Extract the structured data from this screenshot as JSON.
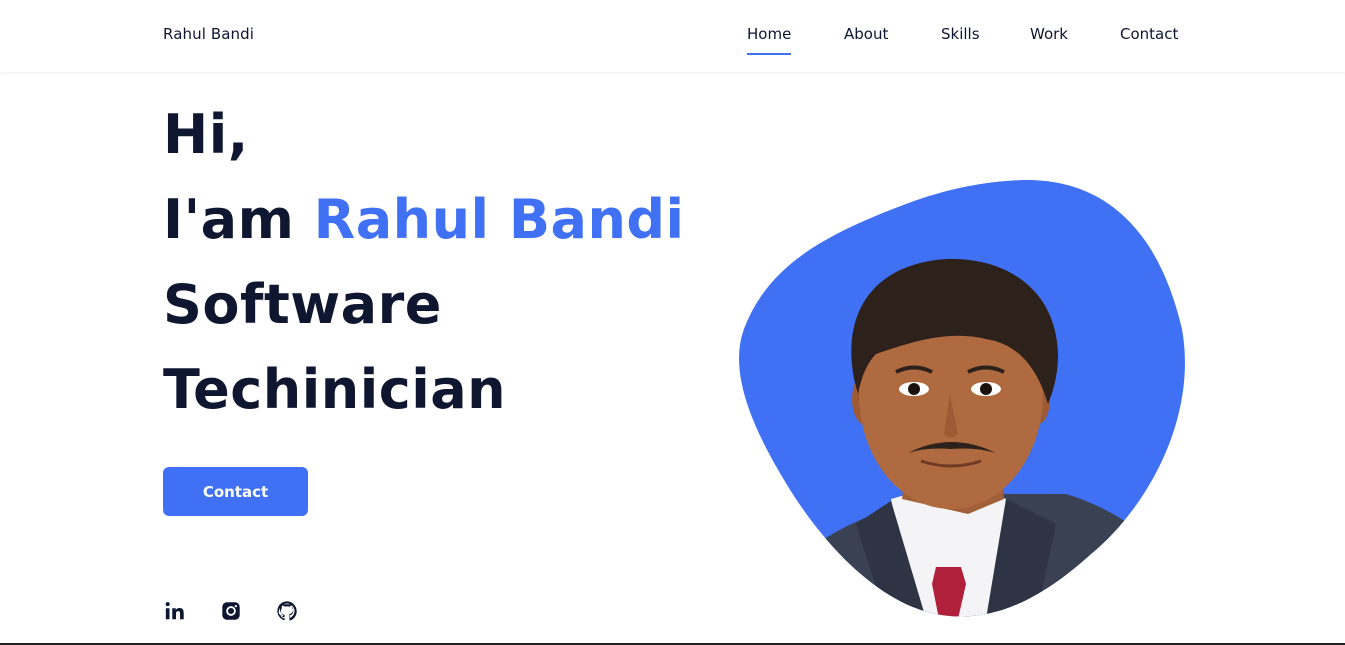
{
  "header": {
    "brand": "Rahul Bandi",
    "nav": [
      "Home",
      "About",
      "Skills",
      "Work",
      "Contact"
    ],
    "active_nav": "Home"
  },
  "hero": {
    "line1": "Hi,",
    "line2_prefix": "I'am ",
    "line2_name": "Rahul Bandi",
    "line3": "Software",
    "line4": "Techinician",
    "cta_label": "Contact"
  },
  "social": [
    "linkedin-icon",
    "instagram-icon",
    "github-icon"
  ],
  "colors": {
    "accent": "#4070f4",
    "text": "#0e1630",
    "background": "#ffffff"
  }
}
